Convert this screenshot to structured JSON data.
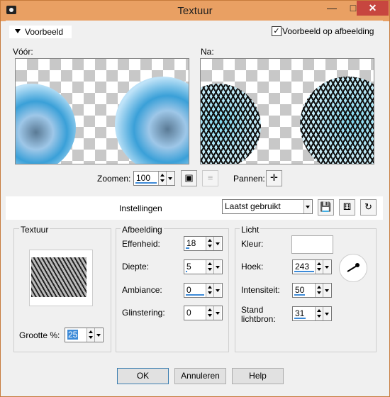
{
  "window": {
    "title": "Textuur"
  },
  "preview": {
    "toggle_label": "Voorbeeld",
    "checkbox_label": "Voorbeeld op afbeelding",
    "checkbox_checked": true,
    "before_label": "Vóór:",
    "after_label": "Na:",
    "zoom_label": "Zoomen:",
    "zoom_value": "100",
    "pan_label": "Pannen:"
  },
  "settings": {
    "label": "Instellingen",
    "preset_value": "Laatst gebruikt"
  },
  "texture_group": {
    "title": "Textuur",
    "size_label": "Grootte %:",
    "size_value": "25"
  },
  "image_group": {
    "title": "Afbeelding",
    "smoothness_label": "Effenheid:",
    "smoothness_value": "18",
    "depth_label": "Diepte:",
    "depth_value": "5",
    "ambiance_label": "Ambiance:",
    "ambiance_value": "0",
    "shininess_label": "Glinstering:",
    "shininess_value": "0"
  },
  "light_group": {
    "title": "Licht",
    "color_label": "Kleur:",
    "color_value": "#ffffff",
    "angle_label": "Hoek:",
    "angle_value": "243",
    "intensity_label": "Intensiteit:",
    "intensity_value": "50",
    "position_label_line1": "Stand",
    "position_label_line2": "lichtbron:",
    "position_value": "31"
  },
  "buttons": {
    "ok": "OK",
    "cancel": "Annuleren",
    "help": "Help"
  },
  "icons": {
    "app": "camera-icon",
    "minimize": "minimize-icon",
    "maximize": "maximize-icon",
    "close": "close-icon",
    "zoom_fit": "zoom-fit-icon",
    "zoom_actual": "zoom-1to1-icon",
    "pan": "pan-crosshair-icon",
    "save_preset": "save-icon",
    "random": "dice-icon",
    "reset": "reset-icon",
    "angle_dial": "angle-dial-icon"
  }
}
